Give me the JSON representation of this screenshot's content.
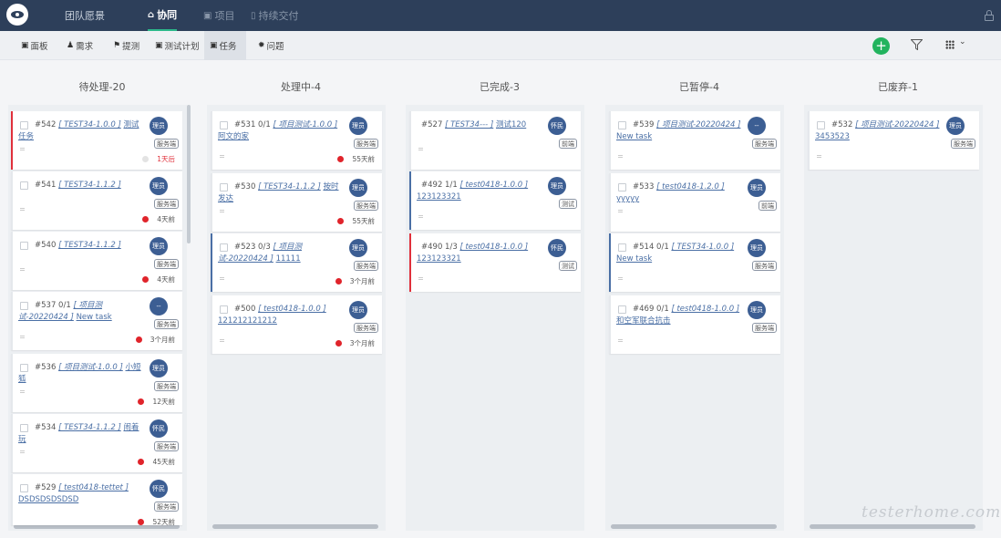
{
  "topnav": {
    "team": "团队愿景",
    "collab": "协同",
    "project": "项目",
    "delivery": "持续交付"
  },
  "subnav": {
    "board": "面板",
    "req": "需求",
    "bug": "提测",
    "testplan": "测试计划",
    "task": "任务",
    "issue": "问题"
  },
  "actions": {
    "add": "+"
  },
  "columns": [
    {
      "title": "待处理-20"
    },
    {
      "title": "处理中-4"
    },
    {
      "title": "已完成-3"
    },
    {
      "title": "已暂停-4"
    },
    {
      "title": "已废弃-1"
    }
  ],
  "cards": {
    "c542": {
      "num": "#542",
      "proj": "[ TEST34-1.0.0 ]",
      "text": "测试任务",
      "avatar": "理员",
      "tag": "服务端",
      "time": "1天后"
    },
    "c541": {
      "num": "#541",
      "proj": "[ TEST34-1.1.2 ]",
      "text": "",
      "avatar": "理员",
      "tag": "服务端",
      "time": "4天前"
    },
    "c540": {
      "num": "#540",
      "proj": "[ TEST34-1.1.2 ]",
      "text": "",
      "avatar": "理员",
      "tag": "服务端",
      "time": "4天前"
    },
    "c537": {
      "num": "#537 0/1",
      "proj": "[ 项目测试-20220424 ]",
      "text": "New task",
      "avatar": "--",
      "tag": "服务端",
      "time": "3个月前"
    },
    "c536": {
      "num": "#536",
      "proj": "[ 项目测试-1.0.0 ]",
      "text": "小短狐",
      "avatar": "理员",
      "tag": "服务端",
      "time": "12天前"
    },
    "c534": {
      "num": "#534",
      "proj": "[ TEST34-1.1.2 ]",
      "text": "闹着玩",
      "avatar": "怀民",
      "tag": "服务端",
      "time": "45天前"
    },
    "c529": {
      "num": "#529",
      "proj": "[ test0418-tettet ]",
      "text": "DSDSDSDSDSD",
      "avatar": "怀民",
      "tag": "服务端",
      "time": "52天前"
    },
    "c531": {
      "num": "#531 0/1",
      "proj": "[ 项目测试-1.0.0 ]",
      "text": "阿文的家",
      "avatar": "理员",
      "tag": "服务端",
      "time": "55天前"
    },
    "c530": {
      "num": "#530",
      "proj": "[ TEST34-1.1.2 ]",
      "text": "按时发达",
      "avatar": "理员",
      "tag": "服务端",
      "time": "55天前"
    },
    "c523": {
      "num": "#523 0/3",
      "proj": "[ 项目测试-20220424 ]",
      "text": "11111",
      "avatar": "理员",
      "tag": "服务端",
      "time": "3个月前"
    },
    "c500": {
      "num": "#500",
      "proj": "[ test0418-1.0.0 ]",
      "text": "121212121212",
      "avatar": "理员",
      "tag": "服务端",
      "time": "3个月前"
    },
    "c527": {
      "num": "#527",
      "proj": "[ TEST34--- ]",
      "text": "测试120",
      "avatar": "怀民",
      "tag": "前端"
    },
    "c492": {
      "num": "#492 1/1",
      "proj": "[ test0418-1.0.0 ]",
      "text": "123123321",
      "avatar": "理员",
      "tag": "测试"
    },
    "c490": {
      "num": "#490 1/3",
      "proj": "[ test0418-1.0.0 ]",
      "text": "123123321",
      "avatar": "怀民",
      "tag": "测试"
    },
    "c539": {
      "num": "#539",
      "proj": "[ 项目测试-20220424 ]",
      "text": "New task",
      "avatar": "--",
      "tag": "服务端"
    },
    "c533": {
      "num": "#533",
      "proj": "[ test0418-1.2.0 ]",
      "text": "yyyyy",
      "avatar": "理员",
      "tag": "前端"
    },
    "c514": {
      "num": "#514 0/1",
      "proj": "[ TEST34-1.0.0 ]",
      "text": "New task",
      "avatar": "理员",
      "tag": "服务端"
    },
    "c469": {
      "num": "#469 0/1",
      "proj": "[ test0418-1.0.0 ]",
      "text": "和空军联合抗击",
      "avatar": "理员",
      "tag": "服务端"
    },
    "c532": {
      "num": "#532",
      "proj": "[ 项目测试-20220424 ]",
      "text": "3453523",
      "avatar": "理员",
      "tag": "服务端"
    }
  },
  "watermark": "testerhome.com"
}
